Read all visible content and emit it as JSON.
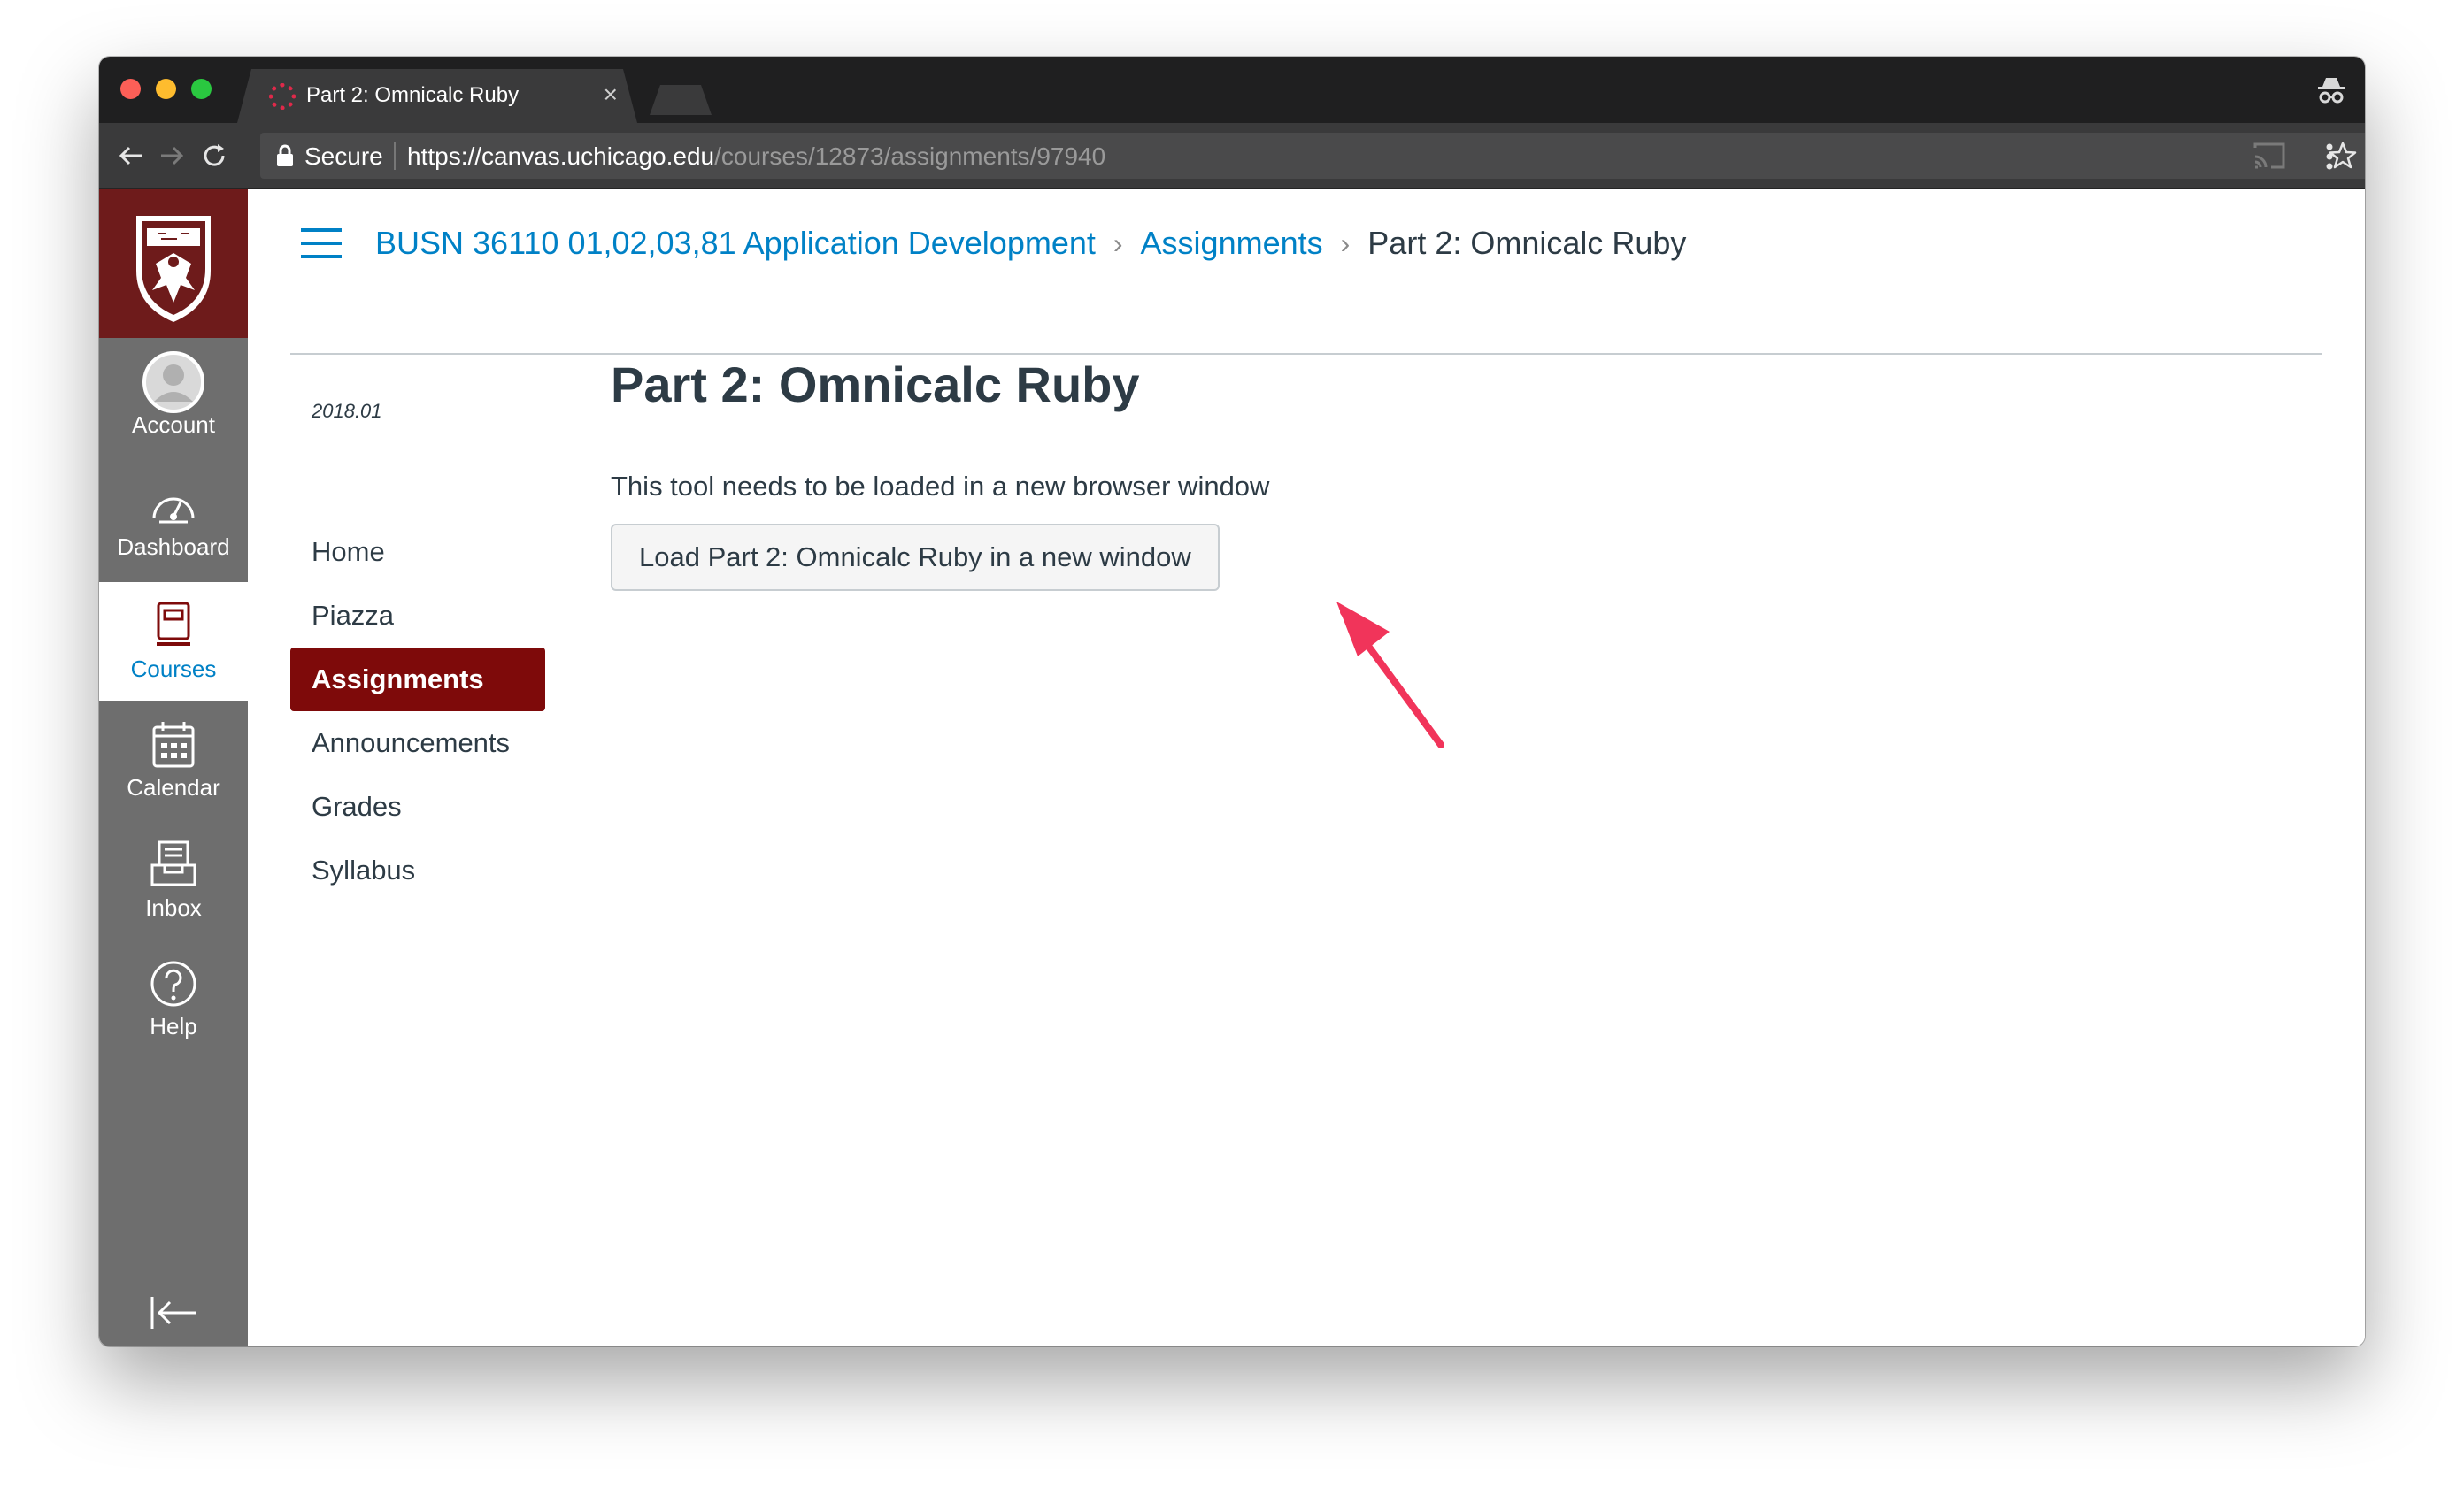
{
  "browser": {
    "tab_title": "Part 2: Omnicalc Ruby",
    "tab_close": "×",
    "omnibox": {
      "security_label": "Secure",
      "url_scheme": "https://",
      "url_host": "canvas.uchicago.edu",
      "url_path": "/courses/12873/assignments/97940"
    }
  },
  "global_nav": {
    "items": [
      {
        "label": "Account",
        "icon": "avatar-icon"
      },
      {
        "label": "Dashboard",
        "icon": "dashboard-icon"
      },
      {
        "label": "Courses",
        "icon": "courses-icon",
        "active": true
      },
      {
        "label": "Calendar",
        "icon": "calendar-icon"
      },
      {
        "label": "Inbox",
        "icon": "inbox-icon"
      },
      {
        "label": "Help",
        "icon": "help-icon"
      }
    ]
  },
  "breadcrumb": {
    "course": "BUSN 36110 01,02,03,81 Application Development",
    "section": "Assignments",
    "current": "Part 2: Omnicalc Ruby",
    "separator": "›"
  },
  "course_nav": {
    "term": "2018.01",
    "items": [
      "Home",
      "Piazza",
      "Assignments",
      "Announcements",
      "Grades",
      "Syllabus"
    ],
    "active": "Assignments"
  },
  "content": {
    "title": "Part 2: Omnicalc Ruby",
    "message": "This tool needs to be loaded in a new browser window",
    "load_button": "Load Part 2: Omnicalc Ruby in a new window"
  },
  "colors": {
    "brand": "#7e0a0a",
    "link": "#0081c6",
    "annotation_arrow": "#f1345a"
  }
}
